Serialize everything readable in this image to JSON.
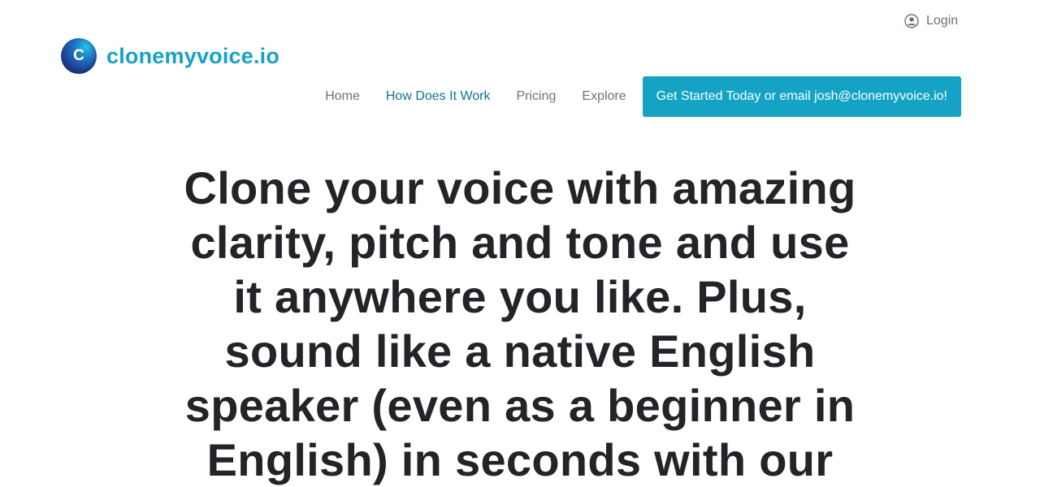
{
  "header": {
    "login_label": "Login",
    "login_icon": "user-circle-icon",
    "brand_letter": "C",
    "brand_name": "clonemyvoice.io"
  },
  "nav": {
    "items": [
      {
        "label": "Home"
      },
      {
        "label": "How Does It Work"
      },
      {
        "label": "Pricing"
      },
      {
        "label": "Explore"
      }
    ],
    "cta_label": "Get Started Today or email josh@clonemyvoice.io!"
  },
  "hero": {
    "headline": "Clone your voice with amazing clarity, pitch and tone and use it anywhere you like. Plus, sound like a native English speaker (even as a beginner in English) in seconds with our"
  },
  "colors": {
    "brand": "#17a2c6",
    "cta_bg": "#14a3c4",
    "nav_active": "#0e7490",
    "nav_text": "#6b7280",
    "headline": "#222428"
  }
}
